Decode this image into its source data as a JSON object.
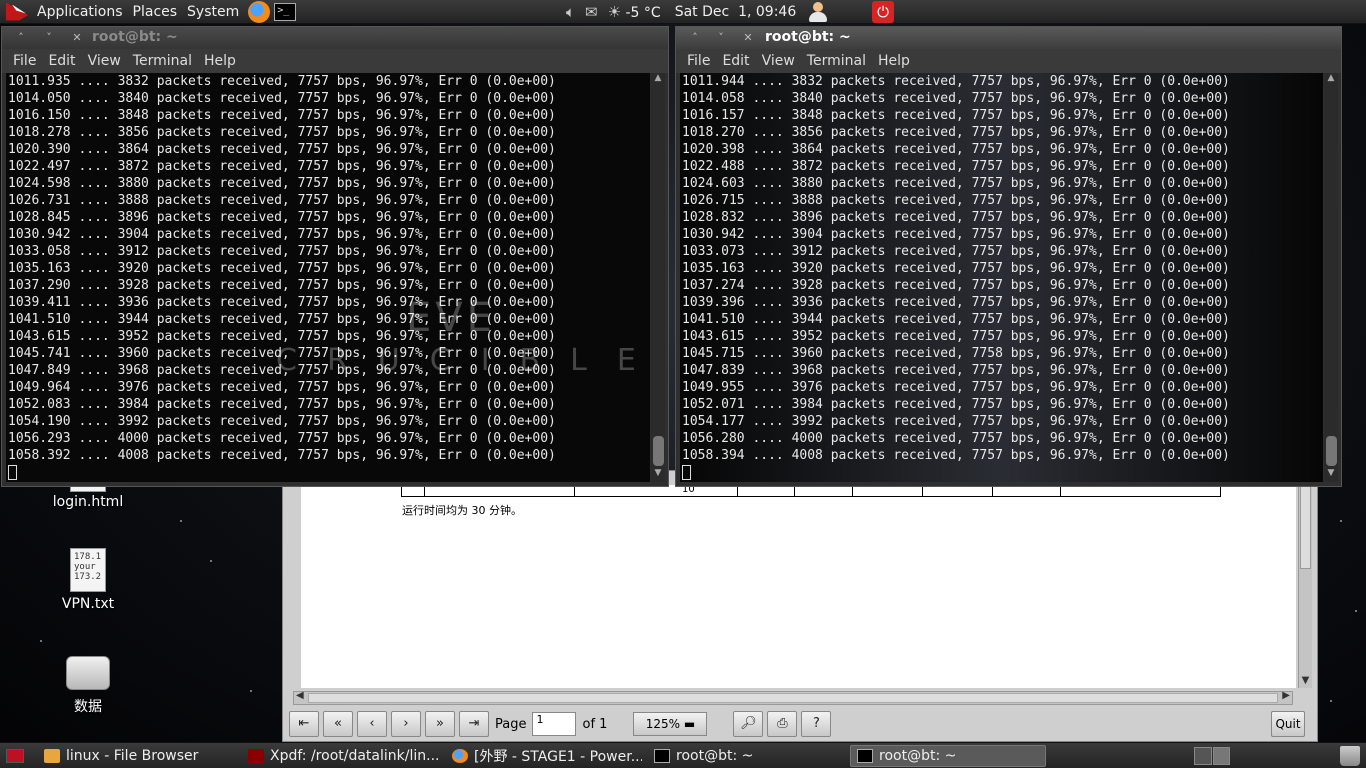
{
  "top_panel": {
    "menus": [
      "Applications",
      "Places",
      "System"
    ],
    "temperature": "-5 °C",
    "datetime": "Sat Dec  1, 09:46"
  },
  "desktop_icons": [
    {
      "label": "login.html",
      "type": "html-file"
    },
    {
      "label": "VPN.txt",
      "type": "text-file",
      "preview": [
        "178.1",
        "your",
        "173.2"
      ]
    },
    {
      "label": "数据",
      "type": "drive"
    }
  ],
  "xpdf": {
    "table_cell_value": "10",
    "text_line": "运行时间均为 30 分钟。",
    "toolbar": {
      "page_label": "Page",
      "page_value": "1",
      "page_of": "of 1",
      "zoom": "125%",
      "quit_label": "Quit"
    }
  },
  "terminal_left": {
    "title": "root@bt: ~",
    "menu": [
      "File",
      "Edit",
      "View",
      "Terminal",
      "Help"
    ],
    "lines": [
      "1011.935 .... 3832 packets received, 7757 bps, 96.97%, Err 0 (0.0e+00)",
      "1014.050 .... 3840 packets received, 7757 bps, 96.97%, Err 0 (0.0e+00)",
      "1016.150 .... 3848 packets received, 7757 bps, 96.97%, Err 0 (0.0e+00)",
      "1018.278 .... 3856 packets received, 7757 bps, 96.97%, Err 0 (0.0e+00)",
      "1020.390 .... 3864 packets received, 7757 bps, 96.97%, Err 0 (0.0e+00)",
      "1022.497 .... 3872 packets received, 7757 bps, 96.97%, Err 0 (0.0e+00)",
      "1024.598 .... 3880 packets received, 7757 bps, 96.97%, Err 0 (0.0e+00)",
      "1026.731 .... 3888 packets received, 7757 bps, 96.97%, Err 0 (0.0e+00)",
      "1028.845 .... 3896 packets received, 7757 bps, 96.97%, Err 0 (0.0e+00)",
      "1030.942 .... 3904 packets received, 7757 bps, 96.97%, Err 0 (0.0e+00)",
      "1033.058 .... 3912 packets received, 7757 bps, 96.97%, Err 0 (0.0e+00)",
      "1035.163 .... 3920 packets received, 7757 bps, 96.97%, Err 0 (0.0e+00)",
      "1037.290 .... 3928 packets received, 7757 bps, 96.97%, Err 0 (0.0e+00)",
      "1039.411 .... 3936 packets received, 7757 bps, 96.97%, Err 0 (0.0e+00)",
      "1041.510 .... 3944 packets received, 7757 bps, 96.97%, Err 0 (0.0e+00)",
      "1043.615 .... 3952 packets received, 7757 bps, 96.97%, Err 0 (0.0e+00)",
      "1045.741 .... 3960 packets received, 7757 bps, 96.97%, Err 0 (0.0e+00)",
      "1047.849 .... 3968 packets received, 7757 bps, 96.97%, Err 0 (0.0e+00)",
      "1049.964 .... 3976 packets received, 7757 bps, 96.97%, Err 0 (0.0e+00)",
      "1052.083 .... 3984 packets received, 7757 bps, 96.97%, Err 0 (0.0e+00)",
      "1054.190 .... 3992 packets received, 7757 bps, 96.97%, Err 0 (0.0e+00)",
      "1056.293 .... 4000 packets received, 7757 bps, 96.97%, Err 0 (0.0e+00)",
      "1058.392 .... 4008 packets received, 7757 bps, 96.97%, Err 0 (0.0e+00)"
    ]
  },
  "terminal_right": {
    "title": "root@bt: ~",
    "menu": [
      "File",
      "Edit",
      "View",
      "Terminal",
      "Help"
    ],
    "lines": [
      "1011.944 .... 3832 packets received, 7757 bps, 96.97%, Err 0 (0.0e+00)",
      "1014.058 .... 3840 packets received, 7757 bps, 96.97%, Err 0 (0.0e+00)",
      "1016.157 .... 3848 packets received, 7757 bps, 96.97%, Err 0 (0.0e+00)",
      "1018.270 .... 3856 packets received, 7757 bps, 96.97%, Err 0 (0.0e+00)",
      "1020.398 .... 3864 packets received, 7757 bps, 96.97%, Err 0 (0.0e+00)",
      "1022.488 .... 3872 packets received, 7757 bps, 96.97%, Err 0 (0.0e+00)",
      "1024.603 .... 3880 packets received, 7757 bps, 96.97%, Err 0 (0.0e+00)",
      "1026.715 .... 3888 packets received, 7757 bps, 96.97%, Err 0 (0.0e+00)",
      "1028.832 .... 3896 packets received, 7757 bps, 96.97%, Err 0 (0.0e+00)",
      "1030.942 .... 3904 packets received, 7757 bps, 96.97%, Err 0 (0.0e+00)",
      "1033.073 .... 3912 packets received, 7757 bps, 96.97%, Err 0 (0.0e+00)",
      "1035.163 .... 3920 packets received, 7757 bps, 96.97%, Err 0 (0.0e+00)",
      "1037.274 .... 3928 packets received, 7757 bps, 96.97%, Err 0 (0.0e+00)",
      "1039.396 .... 3936 packets received, 7757 bps, 96.97%, Err 0 (0.0e+00)",
      "1041.510 .... 3944 packets received, 7757 bps, 96.97%, Err 0 (0.0e+00)",
      "1043.615 .... 3952 packets received, 7757 bps, 96.97%, Err 0 (0.0e+00)",
      "1045.715 .... 3960 packets received, 7758 bps, 96.97%, Err 0 (0.0e+00)",
      "1047.839 .... 3968 packets received, 7757 bps, 96.97%, Err 0 (0.0e+00)",
      "1049.955 .... 3976 packets received, 7757 bps, 96.97%, Err 0 (0.0e+00)",
      "1052.071 .... 3984 packets received, 7757 bps, 96.97%, Err 0 (0.0e+00)",
      "1054.177 .... 3992 packets received, 7757 bps, 96.97%, Err 0 (0.0e+00)",
      "1056.280 .... 4000 packets received, 7757 bps, 96.97%, Err 0 (0.0e+00)",
      "1058.394 .... 4008 packets received, 7757 bps, 96.97%, Err 0 (0.0e+00)"
    ]
  },
  "taskbar": [
    {
      "label": "linux - File Browser",
      "icon": "folder-icon",
      "active": false
    },
    {
      "label": "Xpdf: /root/datalink/lin...",
      "icon": "xpdf-icon",
      "active": false
    },
    {
      "label": "[外野 - STAGE1 - Power...",
      "icon": "firefox-icon",
      "active": false
    },
    {
      "label": "root@bt: ~",
      "icon": "terminal-icon",
      "active": false
    },
    {
      "label": "root@bt: ~",
      "icon": "terminal-icon",
      "active": true
    }
  ]
}
